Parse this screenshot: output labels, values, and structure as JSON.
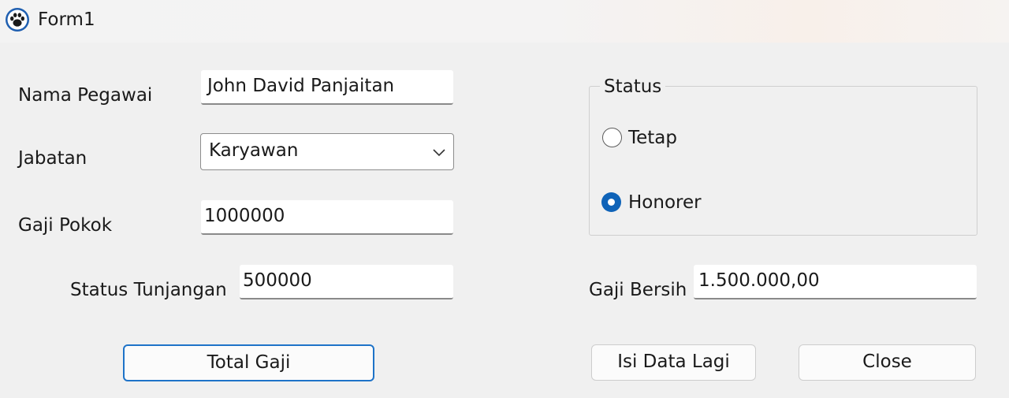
{
  "window": {
    "title": "Form1",
    "icon": "paw-print-icon"
  },
  "form": {
    "nama_pegawai": {
      "label": "Nama Pegawai",
      "value": "John David Panjaitan"
    },
    "jabatan": {
      "label": "Jabatan",
      "selected": "Karyawan"
    },
    "gaji_pokok": {
      "label": "Gaji Pokok",
      "value": "1000000"
    },
    "status_tunjangan": {
      "label": "Status Tunjangan",
      "value": "500000"
    },
    "gaji_bersih": {
      "label": "Gaji Bersih",
      "value": "1.500.000,00"
    }
  },
  "status_group": {
    "title": "Status",
    "options": [
      {
        "label": "Tetap",
        "selected": false
      },
      {
        "label": "Honorer",
        "selected": true
      }
    ]
  },
  "buttons": {
    "total_gaji": "Total Gaji",
    "isi_data_lagi": "Isi Data Lagi",
    "close": "Close"
  },
  "colors": {
    "accent": "#0f63b8",
    "default_button_border": "#1e73c8",
    "background": "#f0f0f0"
  }
}
